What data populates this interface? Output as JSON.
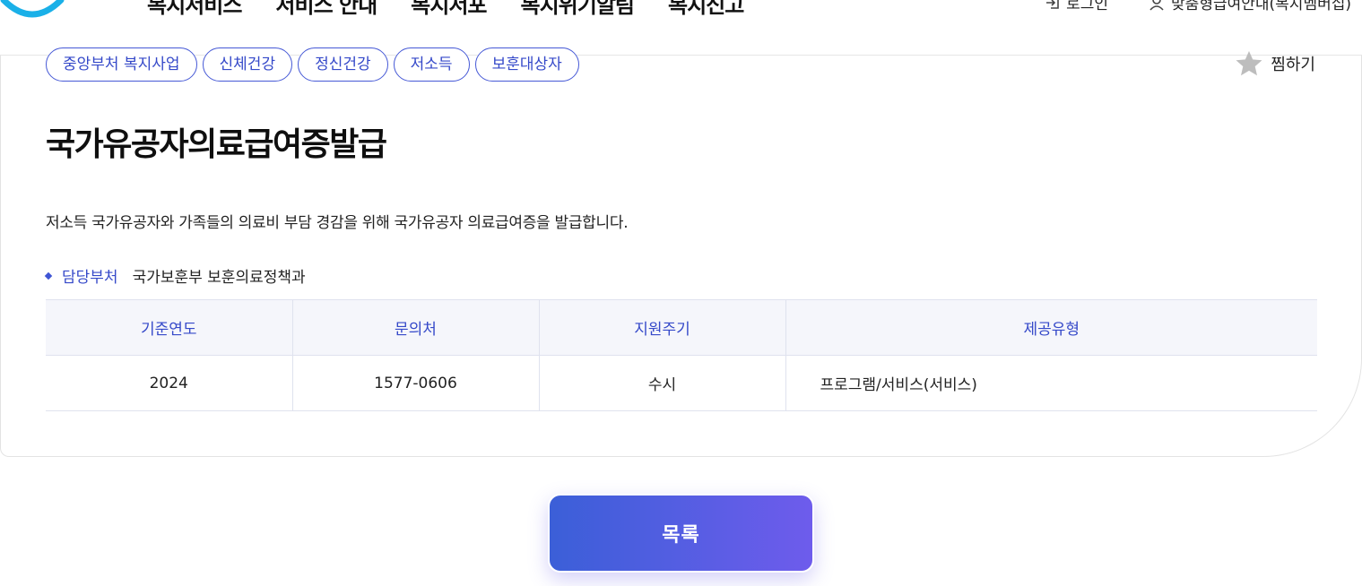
{
  "header": {
    "nav": [
      "복지서비스",
      "서비스 안내",
      "복지서포",
      "복지위기알림",
      "복지신고"
    ],
    "util": {
      "login_label": "로그인",
      "guide_label": "맞춤형급여안내(복지멤버십)"
    }
  },
  "tags": [
    "중앙부처 복지사업",
    "신체건강",
    "정신건강",
    "저소득",
    "보훈대상자"
  ],
  "bookmark_label": "찜하기",
  "title": "국가유공자의료급여증발급",
  "description": "저소득 국가유공자와 가족들의 의료비 부담 경감을 위해 국가유공자 의료급여증을 발급합니다.",
  "department": {
    "label": "담당부처",
    "value": "국가보훈부 보훈의료정책과"
  },
  "info_table": {
    "headers": [
      "기준연도",
      "문의처",
      "지원주기",
      "제공유형"
    ],
    "row": [
      "2024",
      "1577-0606",
      "수시",
      "프로그램/서비스(서비스)"
    ]
  },
  "list_button_label": "목록",
  "colors": {
    "accent": "#3549c9",
    "button_start": "#3b5fd8",
    "button_end": "#6e5cec",
    "table_header_bg": "#f5f6fb",
    "logo": "#1ab0e8"
  }
}
